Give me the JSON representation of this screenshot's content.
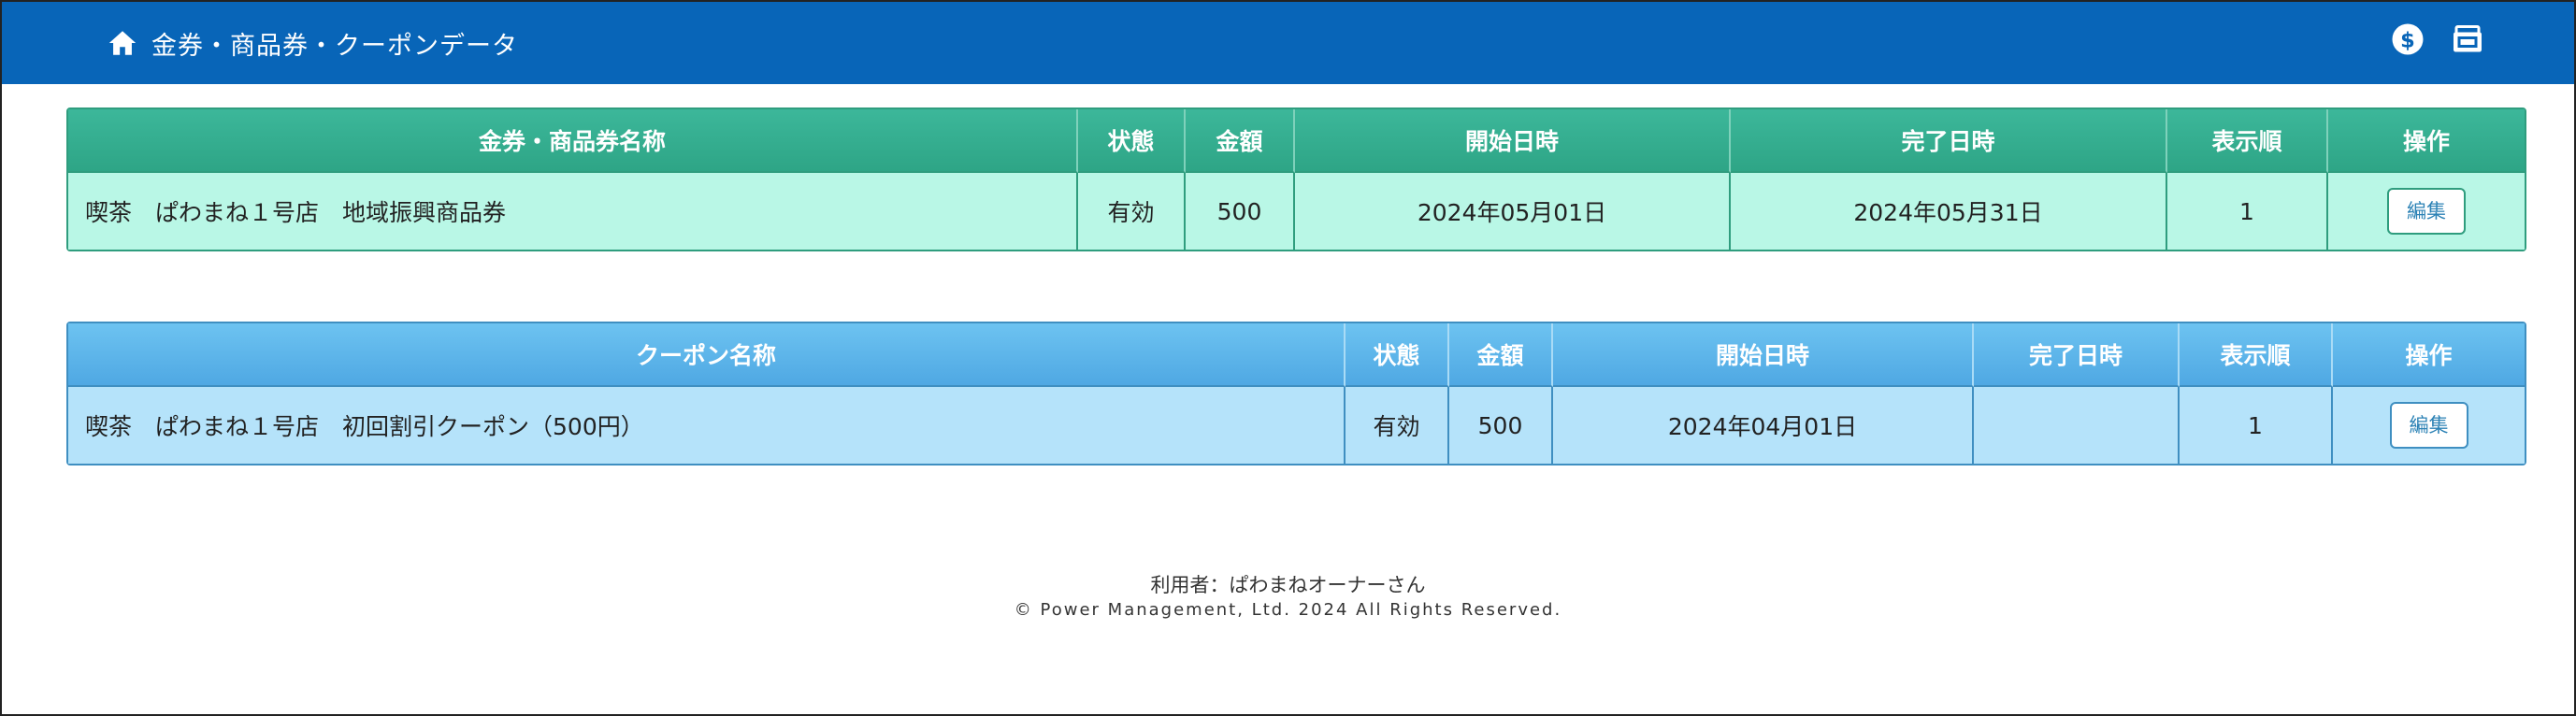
{
  "header": {
    "title": "金券・商品券・クーポンデータ",
    "icons": [
      "home-icon",
      "dollar-circle-icon",
      "coupon-register-icon"
    ],
    "background": "#0865b8"
  },
  "vouchers": {
    "columns": [
      "金券・商品券名称",
      "状態",
      "金額",
      "開始日時",
      "完了日時",
      "表示順",
      "操作"
    ],
    "rows": [
      {
        "name": "喫茶　ぱわまね１号店　地域振興商品券",
        "status": "有効",
        "amount": "500",
        "start": "2024年05月01日",
        "end": "2024年05月31日",
        "order": "1",
        "action": "編集"
      }
    ],
    "header_color": "#35ad8f",
    "row_color": "#b9f7e6"
  },
  "coupons": {
    "columns": [
      "クーポン名称",
      "状態",
      "金額",
      "開始日時",
      "完了日時",
      "表示順",
      "操作"
    ],
    "rows": [
      {
        "name": "喫茶　ぱわまね１号店　初回割引クーポン（500円）",
        "status": "有効",
        "amount": "500",
        "start": "2024年04月01日",
        "end": "",
        "order": "1",
        "action": "編集"
      }
    ],
    "header_color": "#5db6ea",
    "row_color": "#b5e3fa"
  },
  "footer": {
    "user": "利用者：ぱわまねオーナーさん",
    "copyright": "© Power Management, Ltd. 2024 All Rights Reserved."
  }
}
